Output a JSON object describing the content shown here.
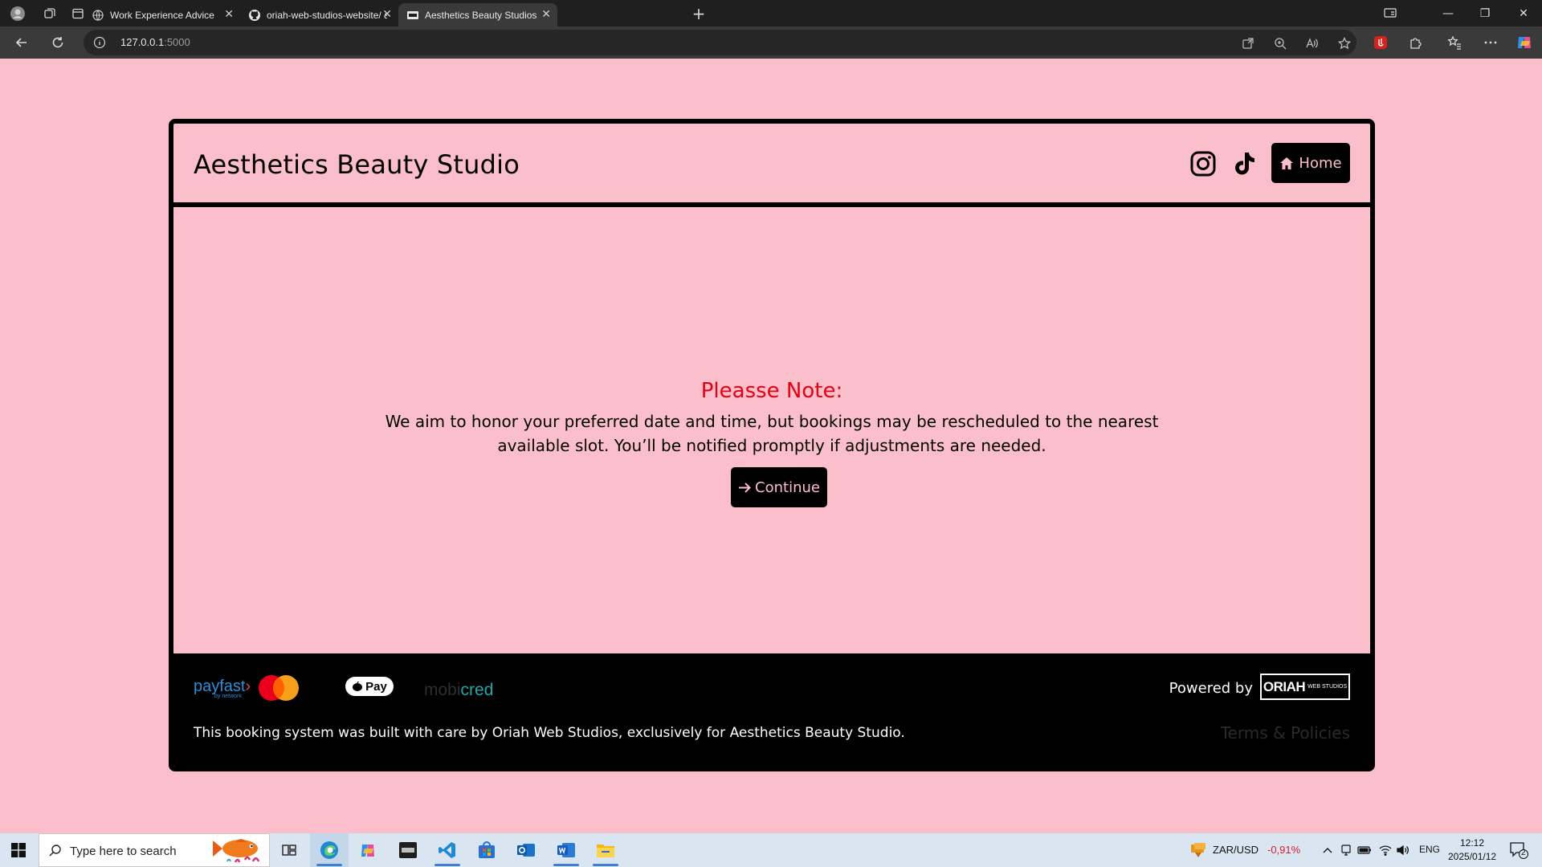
{
  "browser": {
    "tabs": [
      {
        "label": "Work Experience Advice",
        "icon": "globe-icon"
      },
      {
        "label": "oriah-web-studios-website/ at m",
        "icon": "github-icon"
      },
      {
        "label": "Aesthetics Beauty Studios",
        "icon": "site-favicon"
      }
    ],
    "url_host": "127.0.0.1",
    "url_port": ":5000"
  },
  "site": {
    "title": "Aesthetics Beauty Studio",
    "home_label": "Home",
    "note_title": "Pleasse Note:",
    "note_text": "We aim to honor your preferred date and time, but bookings may be rescheduled to the nearest available slot. You’ll be notified promptly if adjustments are needed.",
    "continue_label": "Continue"
  },
  "footer": {
    "payfast_name": "payfast",
    "payfast_sub": "by network",
    "applepay_label": "Pay",
    "mobicred_prefix": "mobi",
    "mobicred_suffix": "cred",
    "powered_by": "Powered by",
    "oriah_name": "ORIAH",
    "oriah_sub": "WEB STUDIOS",
    "credit": "This booking system was built with care by Oriah Web Studios, exclusively for Aesthetics Beauty Studio.",
    "terms": "Terms & Policies"
  },
  "taskbar": {
    "search_placeholder": "Type here to search",
    "currency_pair": "ZAR/USD",
    "currency_change": "-0,91%",
    "language": "ENG",
    "time": "12:12",
    "date": "2025/01/12",
    "notification_count": "2"
  },
  "colors": {
    "page_bg": "#fbbfcb",
    "accent_red": "#e60012",
    "button_bg": "#000000"
  }
}
